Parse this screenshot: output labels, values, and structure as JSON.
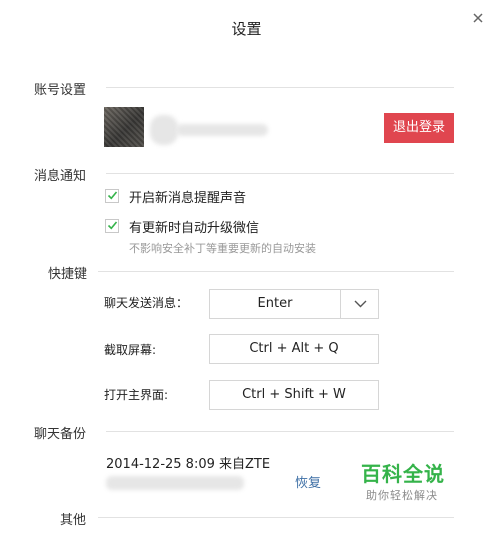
{
  "dialog": {
    "title": "设置",
    "close_icon": "close-icon"
  },
  "account": {
    "section_label": "账号设置",
    "logout_label": "退出登录"
  },
  "notifications": {
    "section_label": "消息通知",
    "options": [
      {
        "label": "开启新消息提醒声音",
        "checked": true
      },
      {
        "label": "有更新时自动升级微信",
        "checked": true
      }
    ],
    "update_hint": "不影响安全补丁等重要更新的自动安装"
  },
  "shortcuts": {
    "section_label": "快捷键",
    "items": [
      {
        "label": "聊天发送消息：",
        "value": "Enter"
      },
      {
        "label": "截取屏幕:",
        "value": "Ctrl + Alt + Q"
      },
      {
        "label": "打开主界面:",
        "value": "Ctrl + Shift + W"
      }
    ]
  },
  "backup": {
    "section_label": "聊天备份",
    "info": "2014-12-25 8:09 来自ZTE",
    "restore_label": "恢复"
  },
  "other": {
    "section_label": "其他"
  },
  "watermark": {
    "main": "百科全说",
    "sub": "助你轻松解决"
  },
  "colors": {
    "logout_bg": "#e0464f",
    "check": "#35b34a",
    "link": "#3c6ea5"
  }
}
